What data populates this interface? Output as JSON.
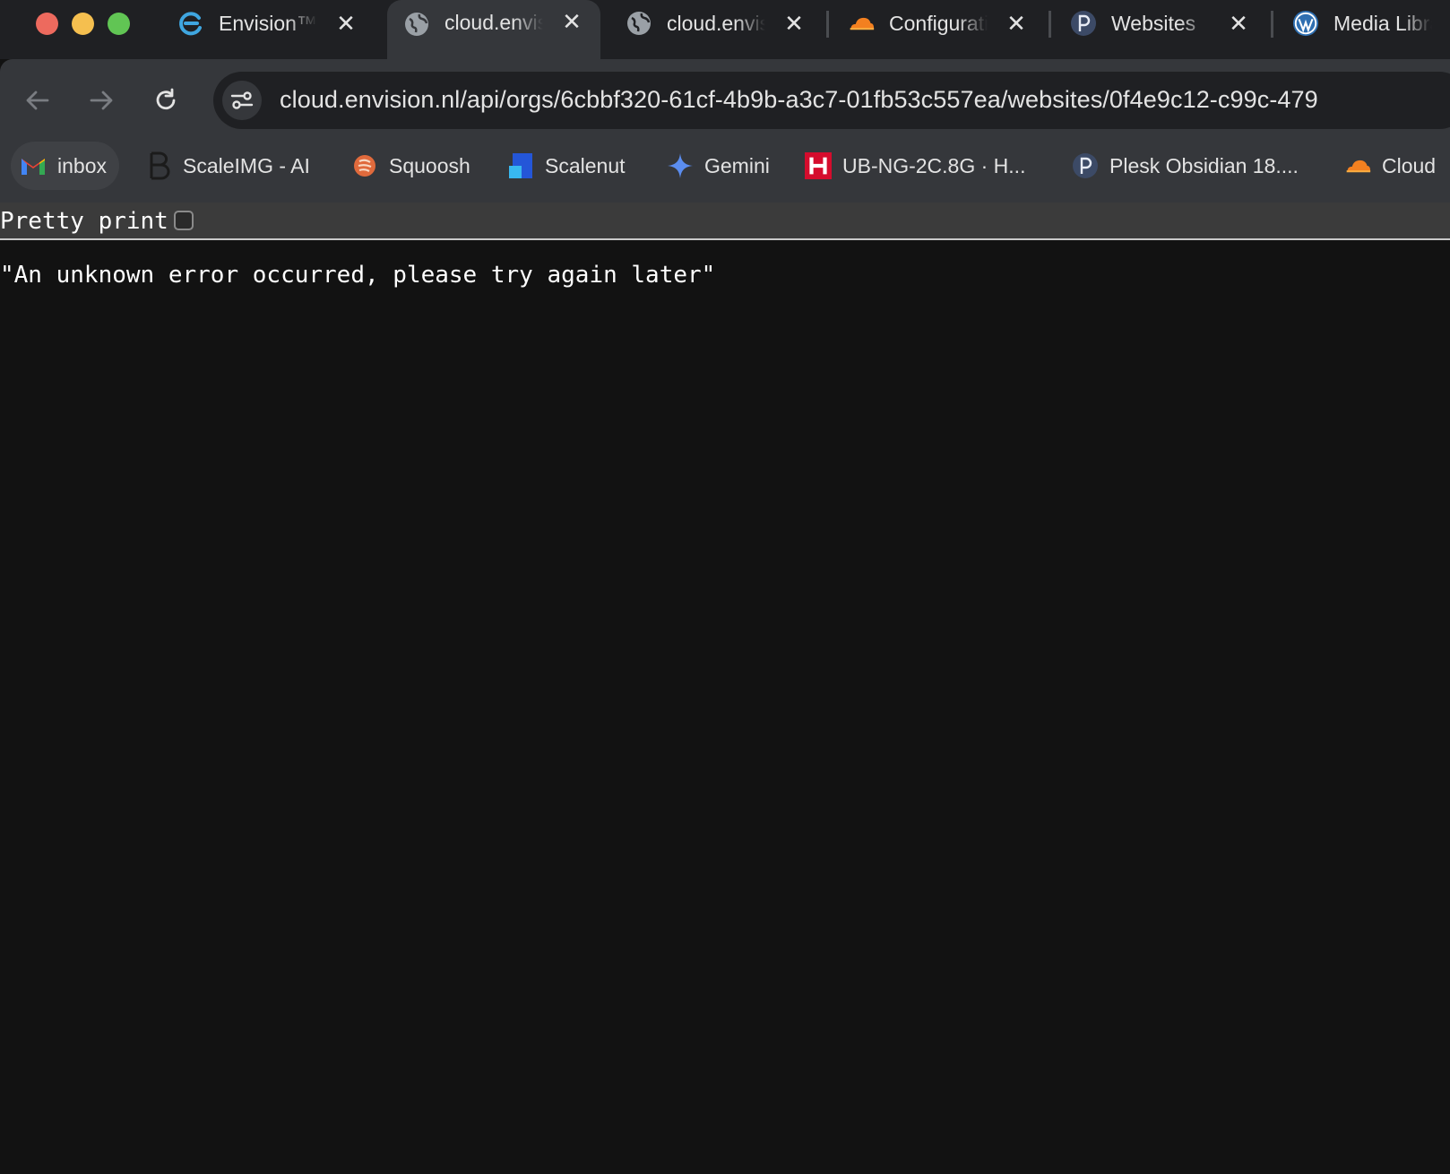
{
  "tabs": [
    {
      "title": "Envision™",
      "icon": "envision-logo-icon",
      "active": false
    },
    {
      "title": "cloud.envision.nl",
      "icon": "globe-icon",
      "active": true
    },
    {
      "title": "cloud.envision.nl",
      "icon": "globe-icon",
      "active": false
    },
    {
      "title": "Configuration",
      "icon": "cloudflare-icon",
      "active": false
    },
    {
      "title": "Websites",
      "icon": "plesk-icon",
      "active": false
    },
    {
      "title": "Media Library",
      "icon": "wordpress-icon",
      "active": false
    }
  ],
  "tab_close_glyph": "✕",
  "address_bar": {
    "url": "cloud.envision.nl/api/orgs/6cbbf320-61cf-4b9b-a3c7-01fb53c557ea/websites/0f4e9c12-c99c-479"
  },
  "bookmarks": [
    {
      "label": "inbox",
      "icon": "gmail-icon"
    },
    {
      "label": "ScaleIMG - AI",
      "icon": "scaleimg-icon"
    },
    {
      "label": "Squoosh",
      "icon": "squoosh-icon"
    },
    {
      "label": "Scalenut",
      "icon": "scalenut-icon"
    },
    {
      "label": "Gemini",
      "icon": "gemini-icon"
    },
    {
      "label": "UB-NG-2C.8G · H...",
      "icon": "hetzner-icon"
    },
    {
      "label": "Plesk Obsidian 18....",
      "icon": "plesk-icon"
    },
    {
      "label": "Cloud",
      "icon": "cloudflare-icon"
    }
  ],
  "json_viewer": {
    "pretty_print_label": "Pretty print",
    "pretty_print_checked": false,
    "body": "\"An unknown error occurred, please try again later\""
  },
  "colors": {
    "page_background": "#121212",
    "toolbar": "#35373b",
    "tabstrip": "#1f2023",
    "cloudflare_orange": "#f38020",
    "hetzner_red": "#d50c2d"
  }
}
